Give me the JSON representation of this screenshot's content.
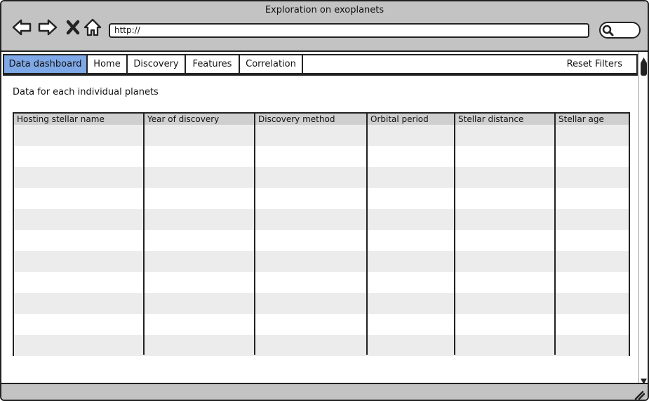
{
  "window": {
    "title": "Exploration on exoplanets"
  },
  "toolbar": {
    "url": "http://",
    "back_icon": "arrow-left-icon",
    "forward_icon": "arrow-right-icon",
    "stop_icon": "close-icon",
    "home_icon": "home-icon",
    "search_icon": "search-icon"
  },
  "tabs": [
    {
      "label": "Data dashboard",
      "active": true
    },
    {
      "label": "Home"
    },
    {
      "label": "Discovery"
    },
    {
      "label": "Features"
    },
    {
      "label": "Correlation"
    }
  ],
  "reset_label": "Reset Filters",
  "caption": "Data for each individual planets",
  "table": {
    "columns": [
      "Hosting stellar name",
      "Year of discovery",
      "Discovery method",
      "Orbital period",
      "Stellar distance",
      "Stellar age"
    ],
    "rows": []
  },
  "colors": {
    "chrome": "#c3c3c3",
    "active_tab": "#7fa8e6",
    "table_header": "#cfcfcf",
    "row_alt": "#ececec"
  }
}
